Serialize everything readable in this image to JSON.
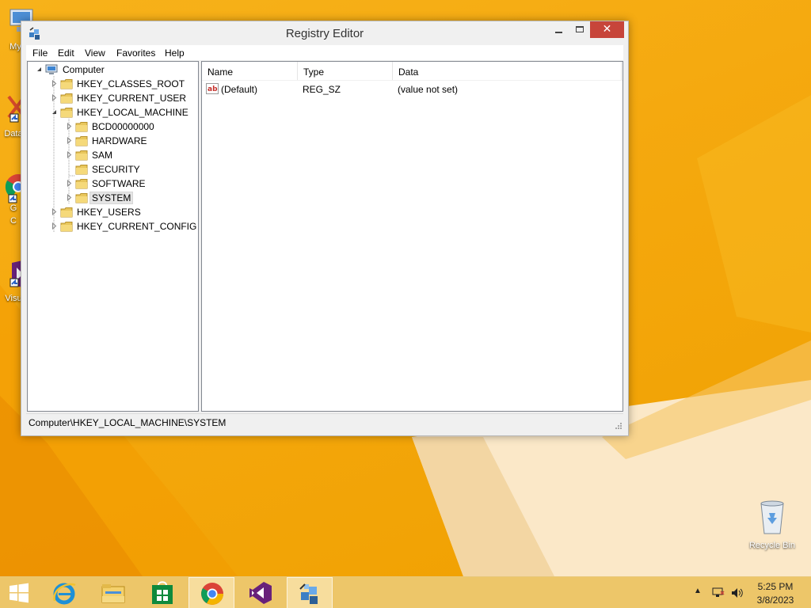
{
  "desktop": {
    "icons": [
      {
        "label": "My C",
        "name": "my-computer-icon"
      },
      {
        "label": "Data",
        "name": "data-shortcut-icon"
      },
      {
        "label": "G\nC",
        "name": "google-chrome-shortcut-icon"
      },
      {
        "label": "Visu",
        "name": "visual-studio-shortcut-icon"
      }
    ],
    "recycle_bin": {
      "label": "Recycle Bin",
      "icon": "recycle-bin-icon"
    }
  },
  "window": {
    "title": "Registry Editor",
    "controls": {
      "minimize": "minimize",
      "maximize": "maximize",
      "close": "✕"
    },
    "menu": [
      "File",
      "Edit",
      "View",
      "Favorites",
      "Help"
    ]
  },
  "tree": {
    "root": "Computer",
    "items": [
      {
        "label": "HKEY_CLASSES_ROOT",
        "level": 1,
        "expander": "collapsed"
      },
      {
        "label": "HKEY_CURRENT_USER",
        "level": 1,
        "expander": "collapsed"
      },
      {
        "label": "HKEY_LOCAL_MACHINE",
        "level": 1,
        "expander": "expanded"
      },
      {
        "label": "BCD00000000",
        "level": 2,
        "expander": "collapsed"
      },
      {
        "label": "HARDWARE",
        "level": 2,
        "expander": "collapsed"
      },
      {
        "label": "SAM",
        "level": 2,
        "expander": "collapsed"
      },
      {
        "label": "SECURITY",
        "level": 2,
        "expander": "none"
      },
      {
        "label": "SOFTWARE",
        "level": 2,
        "expander": "collapsed"
      },
      {
        "label": "SYSTEM",
        "level": 2,
        "expander": "collapsed",
        "selected": true
      },
      {
        "label": "HKEY_USERS",
        "level": 1,
        "expander": "collapsed"
      },
      {
        "label": "HKEY_CURRENT_CONFIG",
        "level": 1,
        "expander": "collapsed"
      }
    ]
  },
  "list": {
    "columns": [
      "Name",
      "Type",
      "Data"
    ],
    "rows": [
      {
        "name": "(Default)",
        "type": "REG_SZ",
        "data": "(value not set)",
        "icon": "string-value-icon"
      }
    ]
  },
  "status": {
    "path": "Computer\\HKEY_LOCAL_MACHINE\\SYSTEM"
  },
  "taskbar": {
    "apps": [
      {
        "name": "start",
        "icon": "windows-start-icon"
      },
      {
        "name": "internet-explorer",
        "icon": "internet-explorer-icon"
      },
      {
        "name": "file-explorer",
        "icon": "file-explorer-icon"
      },
      {
        "name": "store",
        "icon": "store-icon"
      },
      {
        "name": "chrome",
        "icon": "chrome-icon",
        "active": true
      },
      {
        "name": "visual-studio",
        "icon": "visual-studio-icon"
      },
      {
        "name": "registry-editor",
        "icon": "registry-editor-icon",
        "active": true
      }
    ],
    "tray": {
      "time": "5:25 PM",
      "date": "3/8/2023"
    }
  },
  "colors": {
    "wallpaper": "#f5a90f",
    "close_button": "#c7453a",
    "selection": "#e5e5e5"
  }
}
